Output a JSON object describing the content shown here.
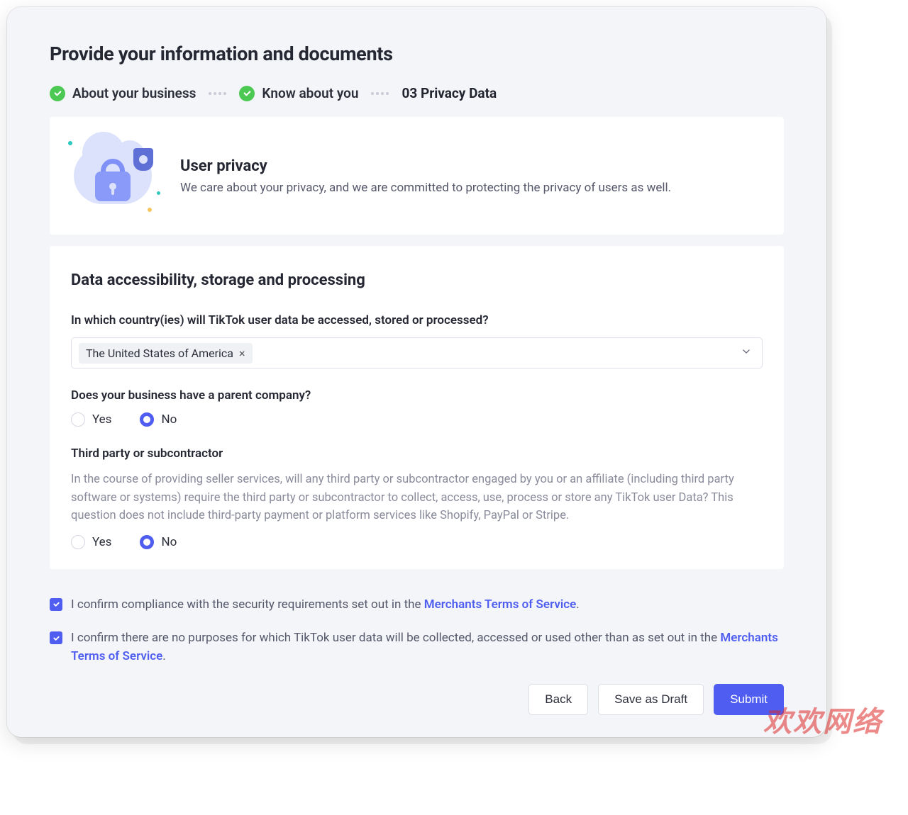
{
  "page": {
    "title": "Provide your information and documents"
  },
  "stepper": {
    "steps": [
      {
        "label": "About your business",
        "done": true
      },
      {
        "label": "Know about you",
        "done": true
      }
    ],
    "current": "03 Privacy Data"
  },
  "privacy_banner": {
    "title": "User privacy",
    "subtitle": "We care about your privacy, and we are committed to protecting the privacy of users as well."
  },
  "form": {
    "section_title": "Data accessibility, storage and processing",
    "country": {
      "label": "In which country(ies) will TikTok user data be accessed, stored or processed?",
      "chips": [
        "The United States of America"
      ]
    },
    "parent_company": {
      "label": "Does your business have a parent company?",
      "options": {
        "yes": "Yes",
        "no": "No"
      },
      "value": "no"
    },
    "third_party": {
      "label": "Third party or subcontractor",
      "description": "In the course of providing seller services, will any third party or subcontractor engaged by you or an affiliate (including third party software or systems) require the third party or subcontractor to collect, access, use, process or store any TikTok user Data? This question does not include third-party payment or platform services like Shopify, PayPal or Stripe.",
      "options": {
        "yes": "Yes",
        "no": "No"
      },
      "value": "no"
    }
  },
  "confirmations": {
    "c1_prefix": "I confirm compliance with the security requirements set out in the ",
    "c1_link": "Merchants Terms of Service",
    "c1_suffix": ".",
    "c2_prefix": "I confirm there are no purposes for which TikTok user data will be collected, accessed or used other than as set out in the ",
    "c2_link": "Merchants Terms of Service",
    "c2_suffix": "."
  },
  "buttons": {
    "back": "Back",
    "save_draft": "Save as Draft",
    "submit": "Submit"
  },
  "watermark": "欢欢网络"
}
